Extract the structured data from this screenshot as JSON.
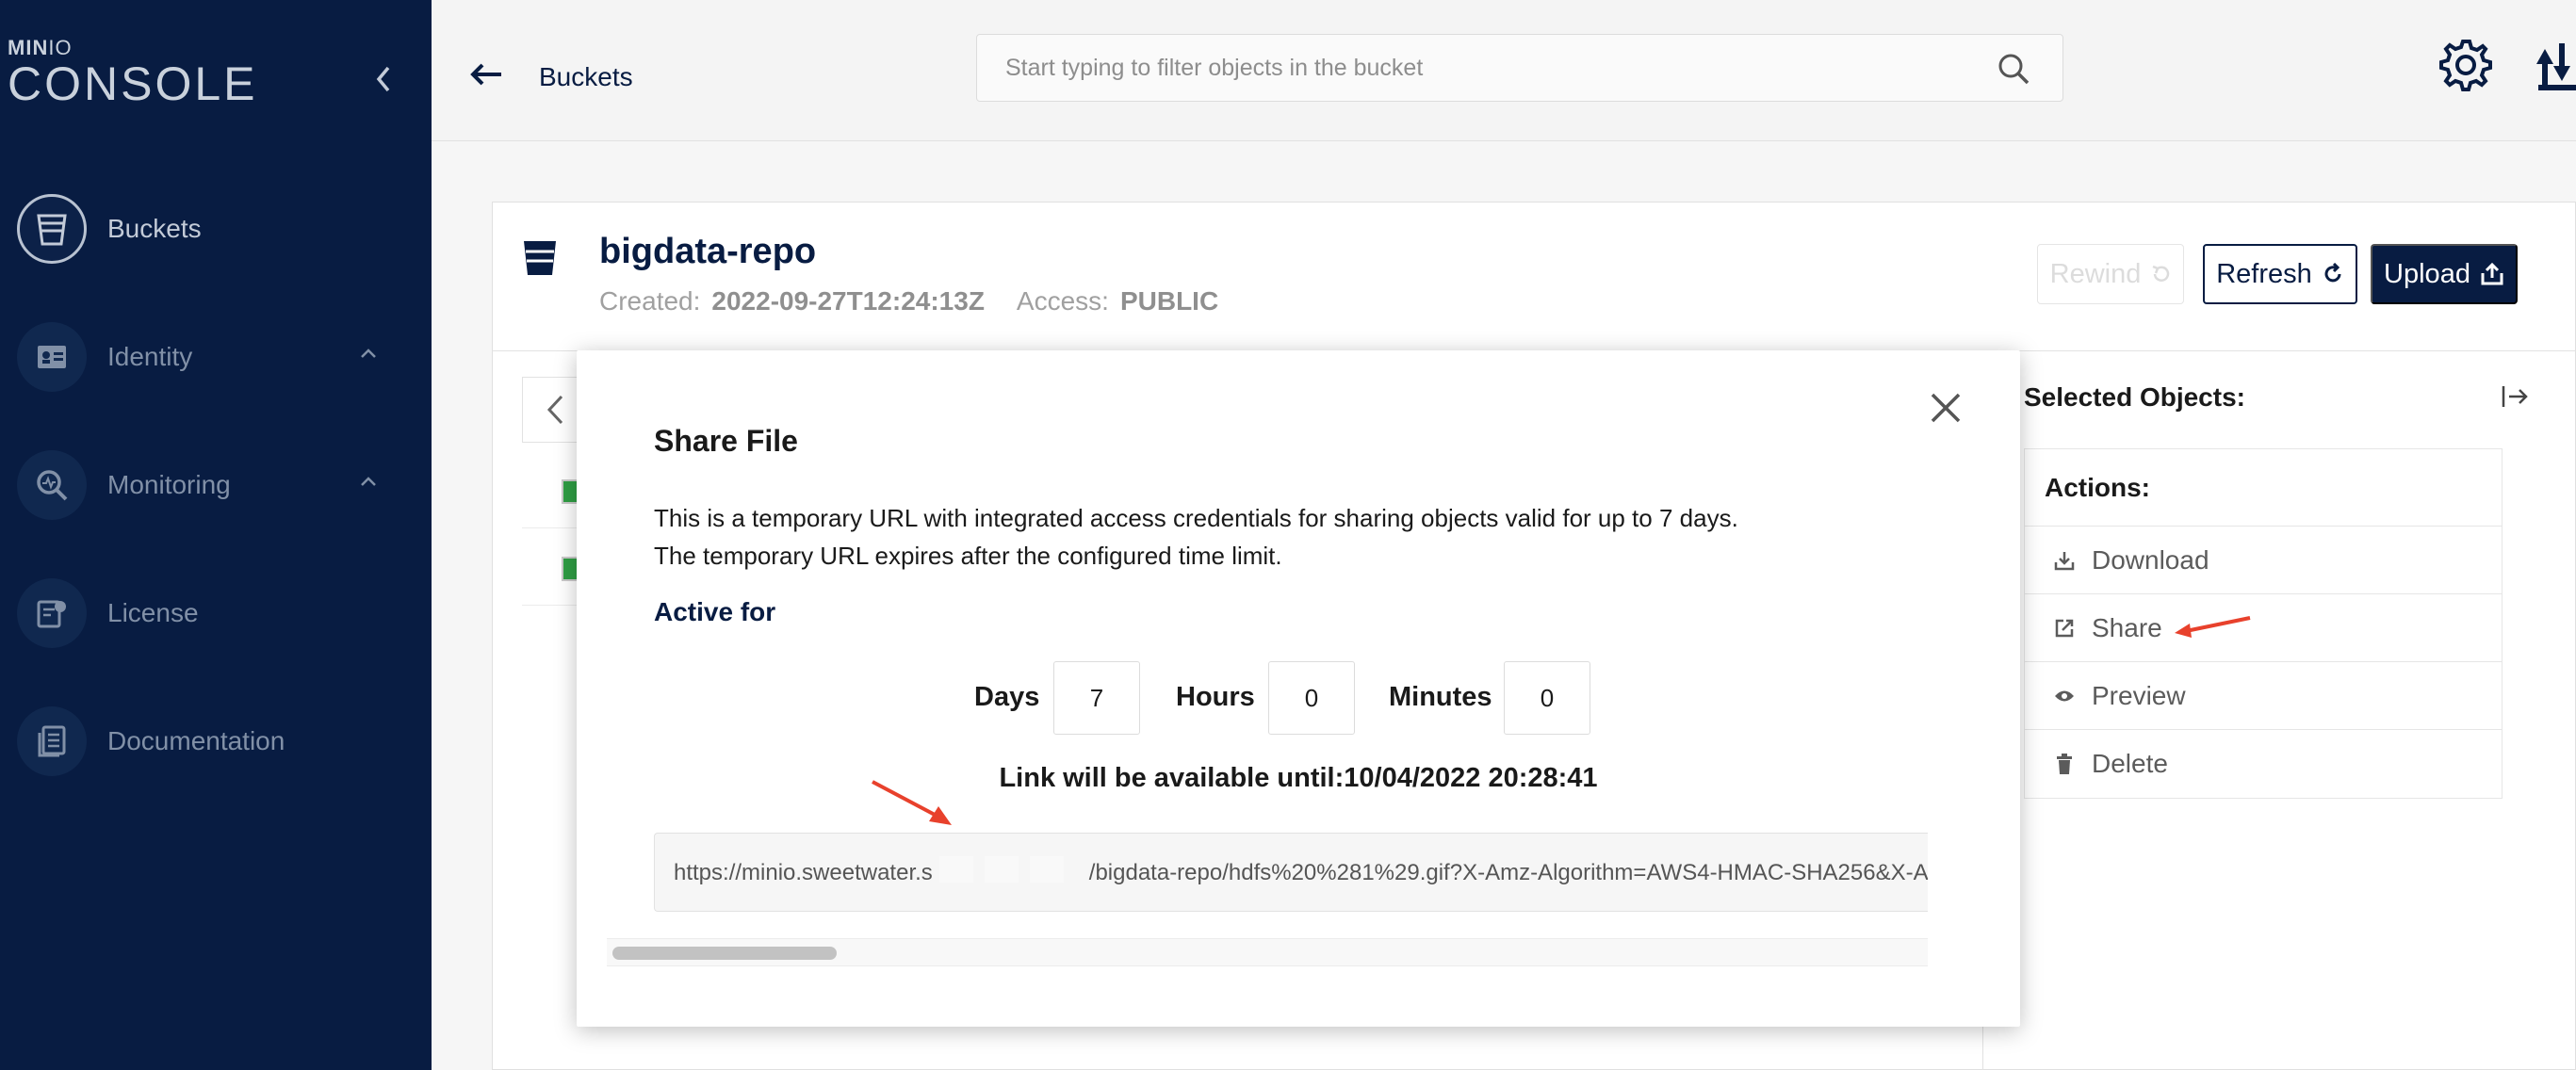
{
  "app": {
    "logo_top_bold": "MIN",
    "logo_top_thin": "IO",
    "logo_big": "CONSOLE"
  },
  "sidebar": {
    "items": [
      {
        "label": "Buckets",
        "icon": "bucket-icon",
        "active": true
      },
      {
        "label": "Identity",
        "icon": "id-card-icon",
        "expandable": true
      },
      {
        "label": "Monitoring",
        "icon": "monitoring-icon",
        "expandable": true
      },
      {
        "label": "License",
        "icon": "license-icon"
      },
      {
        "label": "Documentation",
        "icon": "document-icon"
      }
    ]
  },
  "header": {
    "breadcrumb": "Buckets",
    "search_placeholder": "Start typing to filter objects in the bucket"
  },
  "bucket": {
    "name": "bigdata-repo",
    "created_label": "Created:",
    "created_value": "2022-09-27T12:24:13Z",
    "access_label": "Access:",
    "access_value": "PUBLIC"
  },
  "toolbar": {
    "rewind_label": "Rewind",
    "refresh_label": "Refresh",
    "upload_label": "Upload"
  },
  "selected_panel": {
    "title": "Selected Objects:",
    "actions_title": "Actions:",
    "actions": [
      {
        "label": "Download",
        "icon": "download-icon"
      },
      {
        "label": "Share",
        "icon": "share-icon"
      },
      {
        "label": "Preview",
        "icon": "eye-icon"
      },
      {
        "label": "Delete",
        "icon": "trash-icon"
      }
    ]
  },
  "share_modal": {
    "title": "Share File",
    "desc_line1": "This is a temporary URL with integrated access credentials for sharing objects valid for up to 7 days.",
    "desc_line2": "The temporary URL expires after the configured time limit.",
    "active_for": "Active for",
    "days_label": "Days",
    "days_value": "7",
    "hours_label": "Hours",
    "hours_value": "0",
    "minutes_label": "Minutes",
    "minutes_value": "0",
    "availability": "Link will be available until:10/04/2022 20:28:41",
    "url_prefix": "https://minio.sweetwater.s",
    "url_suffix": "/bigdata-repo/hdfs%20%281%29.gif?X-Amz-Algorithm=AWS4-HMAC-SHA256&X-A"
  },
  "colors": {
    "sidebar_bg": "#081c42",
    "accent_navy": "#081c42",
    "annotation_red": "#e8412c",
    "checkbox_green": "#2f9e44"
  }
}
